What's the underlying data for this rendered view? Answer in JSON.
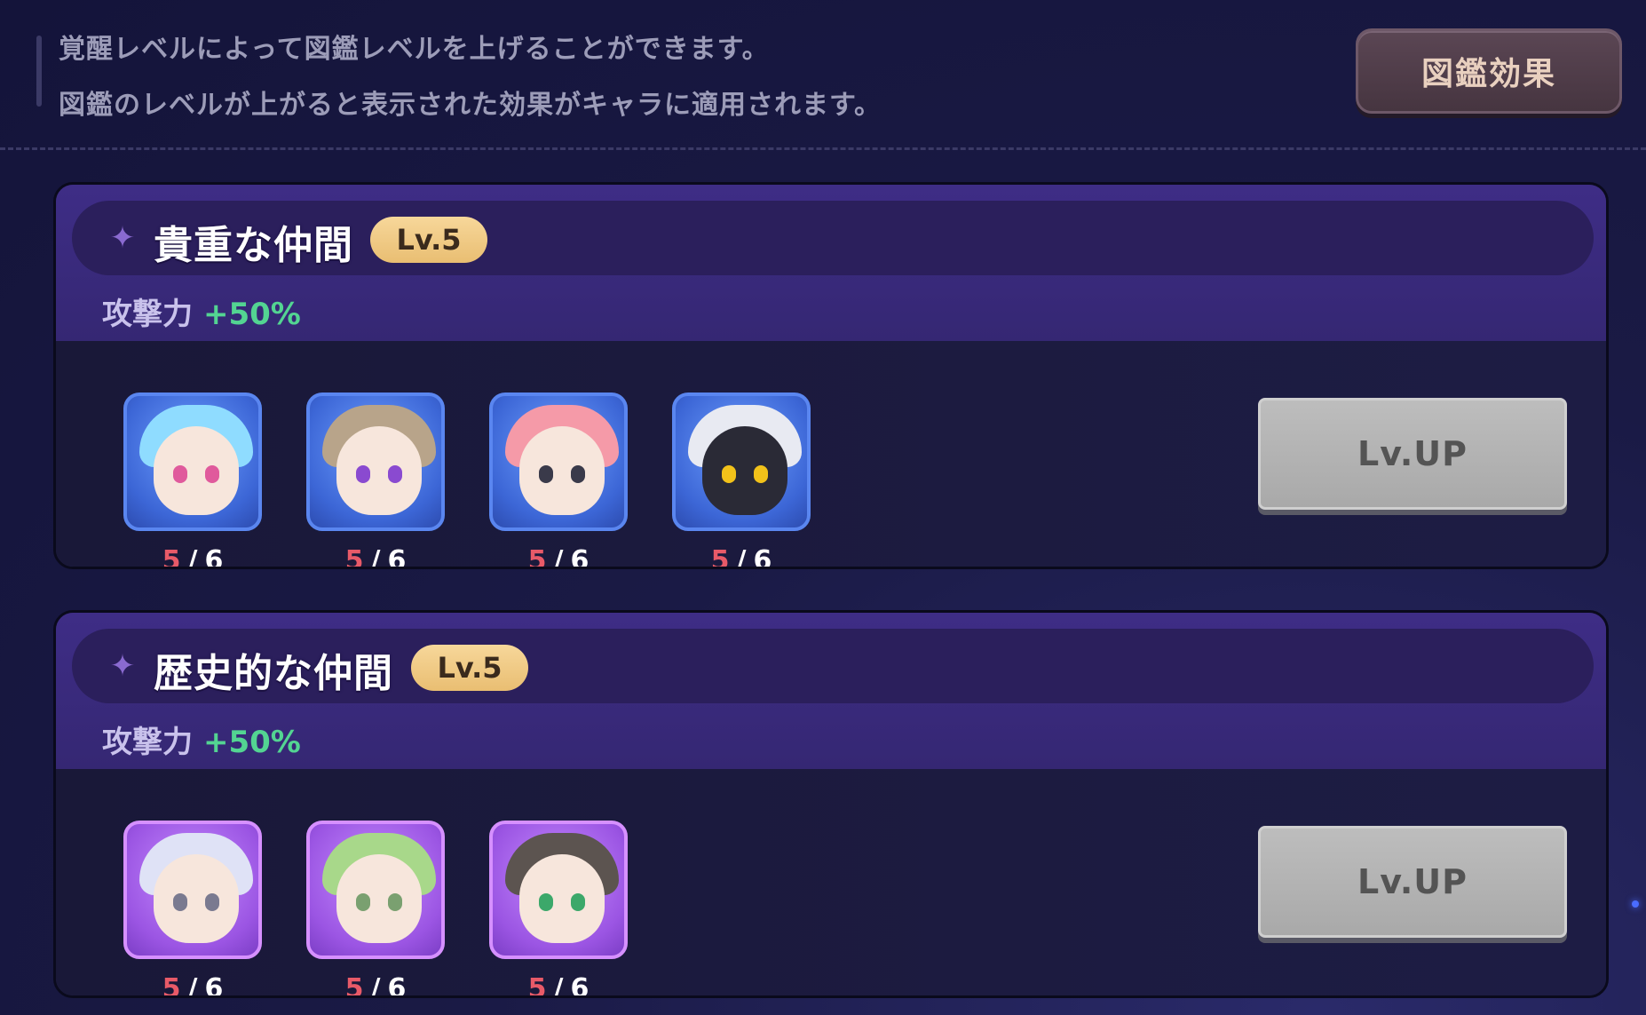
{
  "info": {
    "line1": "覚醒レベルによって図鑑レベルを上げることができます。",
    "line2": "図鑑のレベルが上がると表示された効果がキャラに適用されます。"
  },
  "effect_button_label": "図鑑効果",
  "groups": [
    {
      "title": "貴重な仲間",
      "level": "Lv.5",
      "stat_label": "攻撃力",
      "stat_value": "+50%",
      "button_label": "Lv.UP",
      "characters": [
        {
          "current": "5",
          "max": "6"
        },
        {
          "current": "5",
          "max": "6"
        },
        {
          "current": "5",
          "max": "6"
        },
        {
          "current": "5",
          "max": "6"
        }
      ]
    },
    {
      "title": "歴史的な仲間",
      "level": "Lv.5",
      "stat_label": "攻撃力",
      "stat_value": "+50%",
      "button_label": "Lv.UP",
      "characters": [
        {
          "current": "5",
          "max": "6"
        },
        {
          "current": "5",
          "max": "6"
        },
        {
          "current": "5",
          "max": "6"
        }
      ]
    }
  ],
  "count_separator": "/",
  "colors": {
    "stat_value": "#53d492",
    "level_badge": "#f0c882",
    "count_current": "#e85a68",
    "frame_blue": "#5a86f0",
    "frame_purple": "#d690ff"
  }
}
